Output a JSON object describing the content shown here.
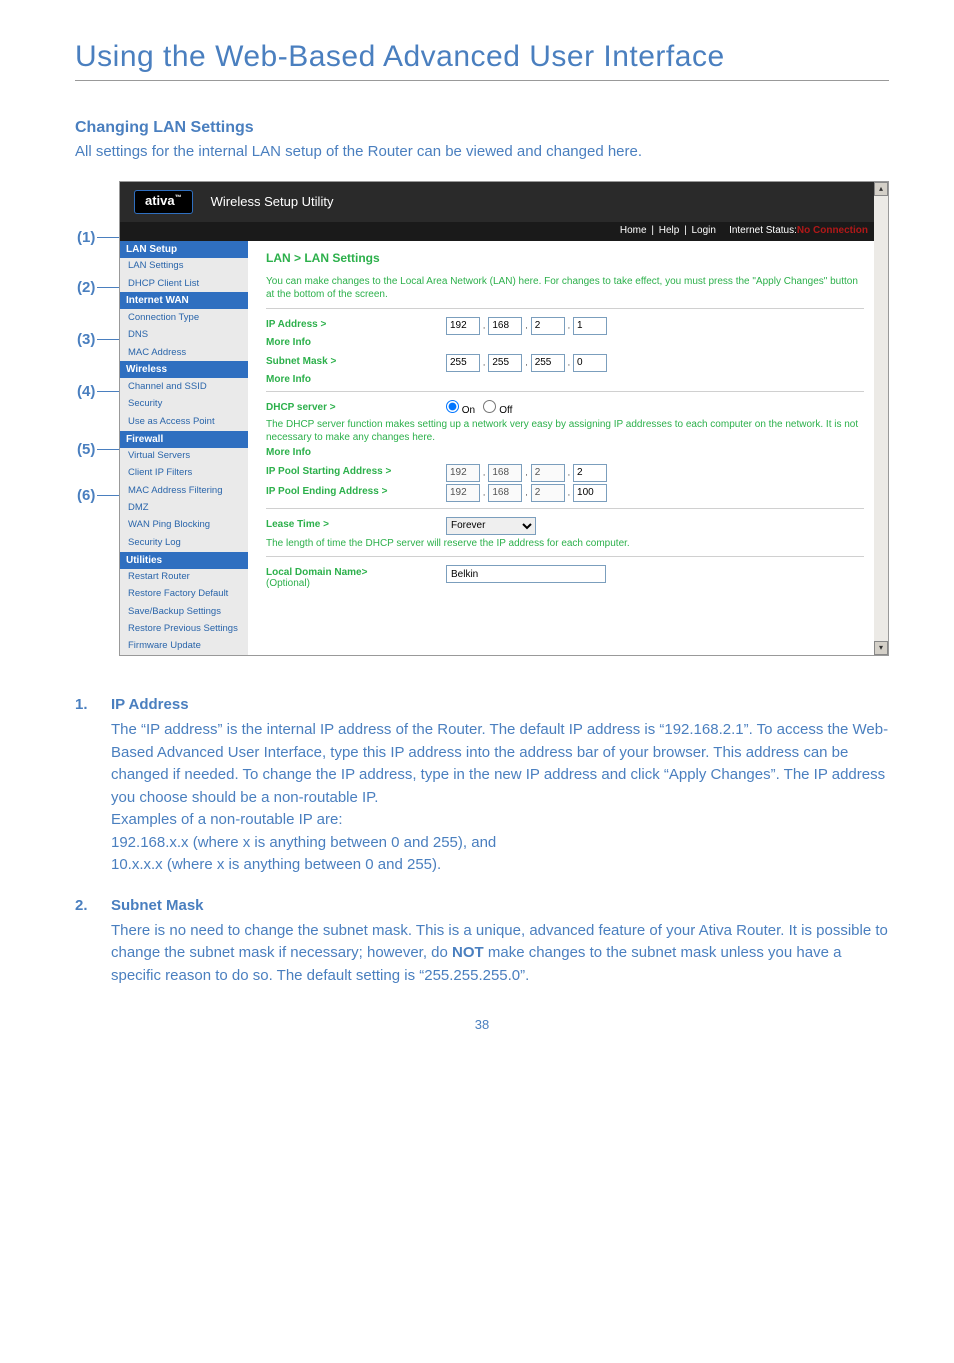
{
  "page_title": "Using the Web-Based Advanced User Interface",
  "section_heading": "Changing LAN Settings",
  "section_intro": "All settings for the internal LAN setup of the Router can be viewed and changed here.",
  "callouts": [
    "(1)",
    "(2)",
    "(3)",
    "(4)",
    "(5)",
    "(6)"
  ],
  "router": {
    "brand": "ativa",
    "utility_title": "Wireless Setup Utility",
    "status_links": [
      "Home",
      "Help",
      "Login"
    ],
    "status_label": "Internet Status:",
    "status_value": "No Connection",
    "sidebar": {
      "groups": [
        {
          "title": "LAN Setup",
          "items": [
            "LAN Settings",
            "DHCP Client List"
          ]
        },
        {
          "title": "Internet WAN",
          "items": [
            "Connection Type",
            "DNS",
            "MAC Address"
          ]
        },
        {
          "title": "Wireless",
          "items": [
            "Channel and SSID",
            "Security",
            "Use as Access Point"
          ]
        },
        {
          "title": "Firewall",
          "items": [
            "Virtual Servers",
            "Client IP Filters",
            "MAC Address Filtering",
            "DMZ",
            "WAN Ping Blocking",
            "Security Log"
          ]
        },
        {
          "title": "Utilities",
          "items": [
            "Restart Router",
            "Restore Factory Default",
            "Save/Backup Settings",
            "Restore Previous Settings",
            "Firmware Update"
          ]
        }
      ]
    },
    "content": {
      "breadcrumb": "LAN > LAN Settings",
      "desc": "You can make changes to the Local Area Network (LAN) here. For changes to take effect, you must press the \"Apply Changes\" button at the bottom of the screen.",
      "ip_label": "IP Address >",
      "ip": [
        "192",
        "168",
        "2",
        "1"
      ],
      "more_info": "More Info",
      "subnet_label": "Subnet Mask >",
      "subnet": [
        "255",
        "255",
        "255",
        "0"
      ],
      "dhcp_label": "DHCP server >",
      "dhcp_on": "On",
      "dhcp_off": "Off",
      "dhcp_desc": "The DHCP server function makes setting up a network very easy by assigning IP addresses to each computer on the network. It is not necessary to make any changes here.",
      "pool_start_label": "IP Pool Starting Address >",
      "pool_start": [
        "192",
        "168",
        "2",
        "2"
      ],
      "pool_end_label": "IP Pool Ending Address >",
      "pool_end": [
        "192",
        "168",
        "2",
        "100"
      ],
      "lease_label": "Lease Time >",
      "lease_value": "Forever",
      "lease_desc": "The length of time the DHCP server will reserve the IP address for each computer.",
      "local_domain_label": "Local Domain Name>",
      "local_domain_opt": "(Optional)",
      "local_domain_value": "Belkin"
    }
  },
  "list": [
    {
      "num": "1.",
      "title": "IP Address",
      "body_lines": [
        "The “IP address” is the internal IP address of the Router. The default IP address is “192.168.2.1”. To access the Web-Based Advanced User Interface, type this IP address into the address bar of your browser. This address can be changed if needed. To change the IP address, type in the new IP address and click “Apply Changes”. The IP address you choose should be a non-routable IP.",
        "Examples of a non-routable IP are:",
        "192.168.x.x (where x is anything between 0 and 255), and",
        "10.x.x.x (where x is anything between 0 and 255)."
      ]
    },
    {
      "num": "2.",
      "title": "Subnet Mask",
      "body_html": "There is no need to change the subnet mask. This is a unique, advanced feature of your Ativa Router. It is possible to change the subnet mask if necessary; however, do <span class=\"b\">NOT</span> make changes to the subnet mask unless you have a specific reason to do so. The default setting is “255.255.255.0”."
    }
  ],
  "page_number": "38"
}
